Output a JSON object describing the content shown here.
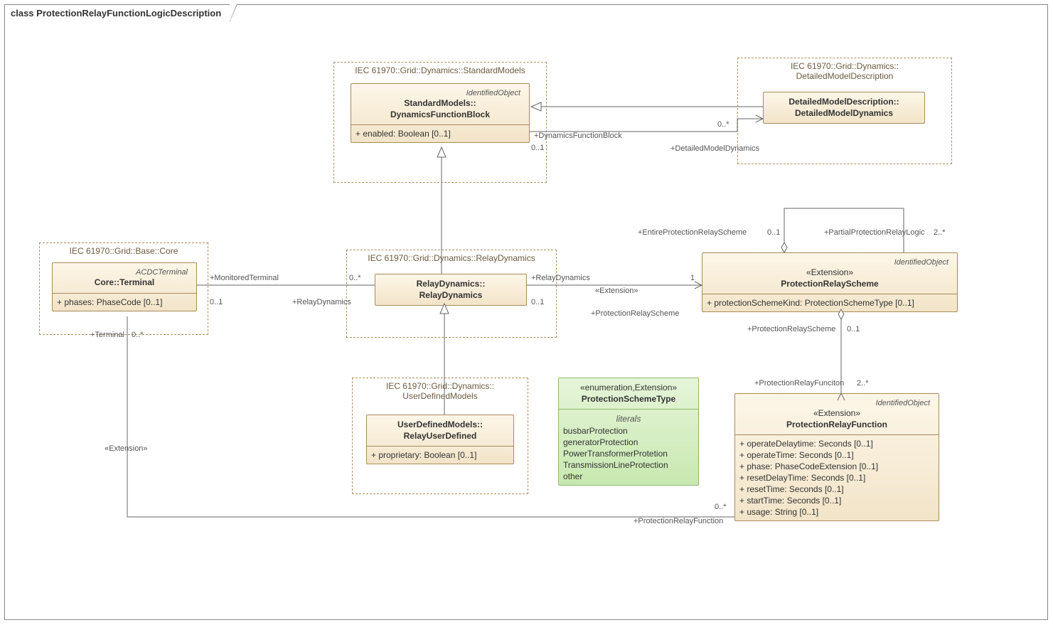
{
  "frameTitle": "class ProtectionRelayFunctionLogicDescription",
  "packages": {
    "standardModels": "IEC 61970::Grid::Dynamics::StandardModels",
    "detailedModelDescription": "IEC 61970::Grid::Dynamics::\nDetailedModelDescription",
    "baseCore": "IEC 61970::Grid::Base::Core",
    "relayDynamics": "IEC 61970::Grid::Dynamics::RelayDynamics",
    "userDefinedModels": "IEC 61970::Grid::Dynamics::\nUserDefinedModels"
  },
  "classes": {
    "dynamicsFunctionBlock": {
      "stereo": "IdentifiedObject",
      "name": "StandardModels::\nDynamicsFunctionBlock",
      "attrs": [
        "+   enabled: Boolean [0..1]"
      ]
    },
    "detailedModelDynamics": {
      "stereo": "",
      "name": "DetailedModelDescription::\nDetailedModelDynamics",
      "attrs": []
    },
    "terminal": {
      "stereo": "ACDCTerminal",
      "name": "Core::Terminal",
      "attrs": [
        "+   phases: PhaseCode [0..1]"
      ]
    },
    "relayDynamics": {
      "stereo": "",
      "name": "RelayDynamics::\nRelayDynamics",
      "attrs": []
    },
    "relayUserDefined": {
      "stereo": "",
      "name": "UserDefinedModels::\nRelayUserDefined",
      "attrs": [
        "+   proprietary: Boolean [0..1]"
      ]
    },
    "protectionSchemeType": {
      "stereo": "«enumeration,Extension»",
      "name": "ProtectionSchemeType",
      "literalsHeader": "literals",
      "literals": [
        "busbarProtection",
        "generatorProtection",
        "PowerTransformerProtetion",
        "TransmissionLineProtection",
        "other"
      ]
    },
    "protectionRelayScheme": {
      "stereo": "IdentifiedObject",
      "stereoExt": "«Extension»",
      "name": "ProtectionRelayScheme",
      "attrs": [
        "+   protectionSchemeKind: ProtectionSchemeType [0..1]"
      ]
    },
    "protectionRelayFunction": {
      "stereo": "IdentifiedObject",
      "stereoExt": "«Extension»",
      "name": "ProtectionRelayFunction",
      "attrs": [
        "+   operateDelaytime: Seconds [0..1]",
        "+   operateTime: Seconds [0..1]",
        "+   phase: PhaseCodeExtension [0..1]",
        "+   resetDelayTime: Seconds [0..1]",
        "+   resetTime: Seconds [0..1]",
        "+   startTime: Seconds [0..1]",
        "+   usage: String [0..1]"
      ]
    }
  },
  "labels": {
    "dynFuncBlock": "+DynamicsFunctionBlock",
    "detailedModelDyn": "+DetailedModelDynamics",
    "m01": "0..1",
    "m0s": "0..*",
    "m1": "1",
    "m2s": "2..*",
    "monitoredTerminal": "+MonitoredTerminal",
    "relayDynamics": "+RelayDynamics",
    "terminal": "+Terminal",
    "relayDynamicsRole": "+RelayDynamics",
    "extension": "«Extension»",
    "protectionRelayScheme": "+ProtectionRelayScheme",
    "protectionRelaySchemeRole": "+ProtectionRelayScheme",
    "protectionRelayFunction": "+ProtectionRelayFunction",
    "protectionRelayFunciton": "+ProtectionRelayFunciton",
    "entireScheme": "+EntireProtectionRelayScheme",
    "partialLogic": "+PartialProtectionRelayLogic"
  }
}
